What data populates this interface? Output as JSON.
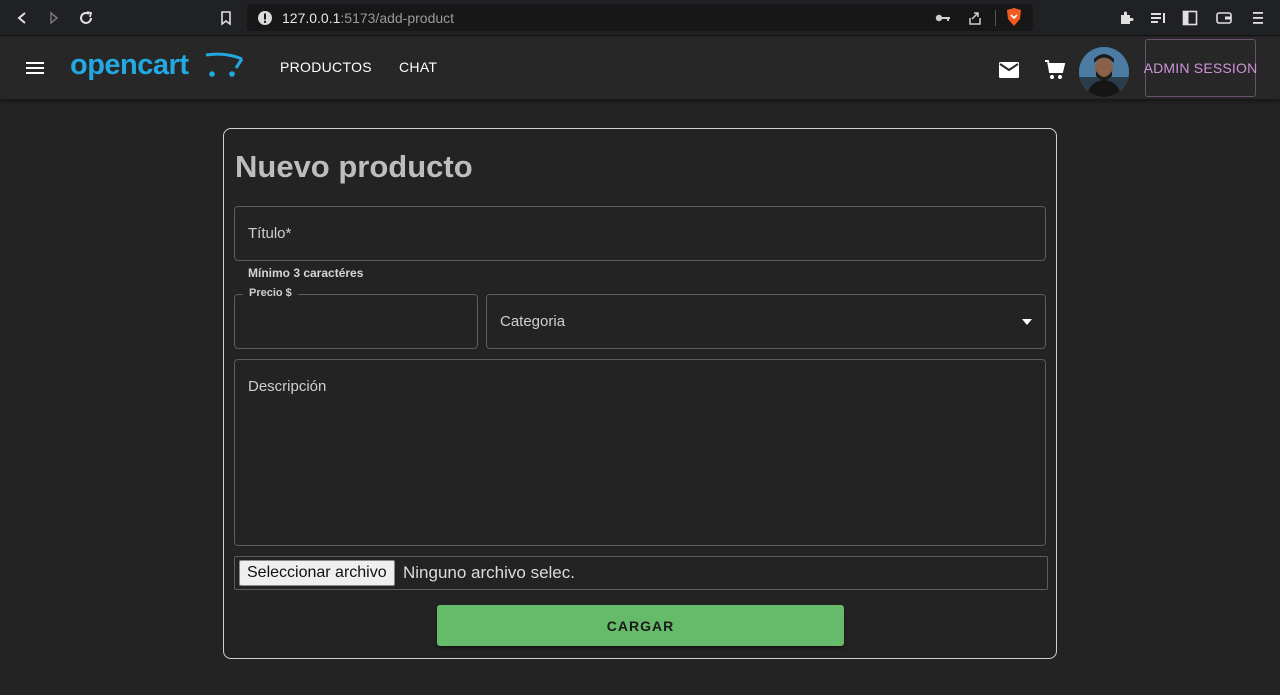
{
  "browser": {
    "url_host": "127.0.0.1",
    "url_rest": ":5173/add-product",
    "icons": [
      "back-icon",
      "forward-icon",
      "reload-icon",
      "bookmark-icon",
      "info-icon",
      "key-icon",
      "share-icon",
      "brave-shield-icon",
      "extensions-icon",
      "playlist-icon",
      "sidebar-icon",
      "wallet-icon",
      "menu-icon"
    ]
  },
  "header": {
    "logo_text": "opencart",
    "nav": [
      {
        "label": "PRODUCTOS"
      },
      {
        "label": "CHAT"
      }
    ],
    "admin_label": "ADMIN SESSION",
    "icons": [
      "mail-icon",
      "cart-icon"
    ]
  },
  "form": {
    "title": "Nuevo producto",
    "titulo_label": "Título*",
    "titulo_helper": "Mínimo 3 caractéres",
    "precio_label": "Precio $",
    "categoria_label": "Categoria",
    "descripcion_label": "Descripción",
    "file_button": "Seleccionar archivo",
    "file_status": "Ninguno archivo selec.",
    "submit_label": "CARGAR"
  },
  "colors": {
    "accent_blue": "#23a8e0",
    "admin_purple": "#ce93d8",
    "submit_green": "#66bb6a",
    "background": "#232323"
  }
}
